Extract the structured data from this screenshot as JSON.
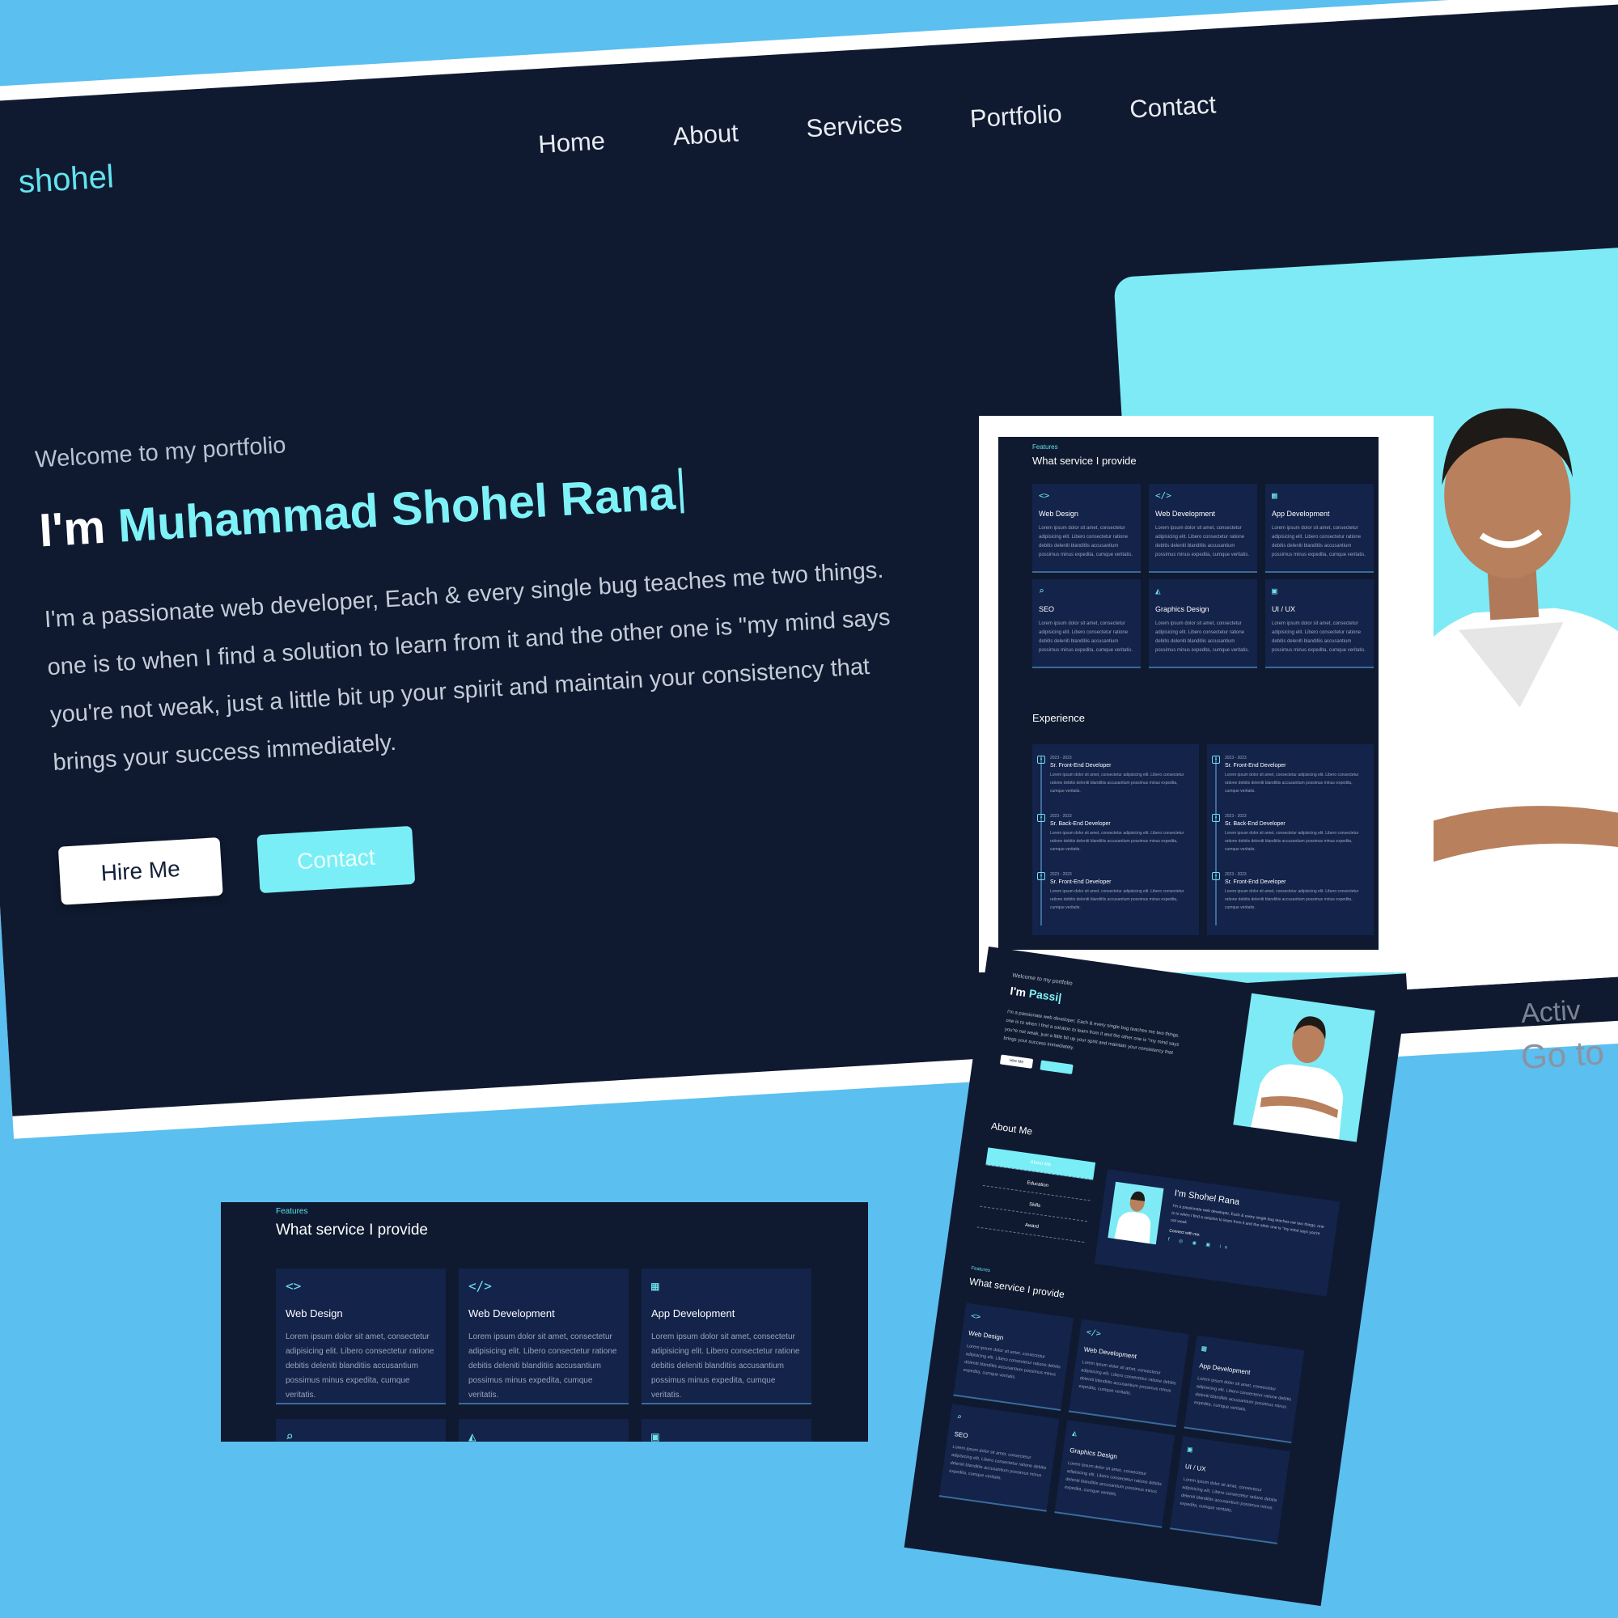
{
  "hero": {
    "logo": "shohel",
    "nav": [
      "Home",
      "About",
      "Services",
      "Portfolio",
      "Contact"
    ],
    "welcome": "Welcome to my portfolio",
    "greeting": "I'm ",
    "name": "Muhammad Shohel Rana",
    "intro": "I'm a passionate web developer, Each & every single bug teaches me two things. one is to when I find a solution to learn from it and the other one is \"my mind says you're not weak, just a little bit up your spirit and maintain your consistency that brings your success immediately.",
    "hire_label": "Hire Me",
    "contact_label": "Contact",
    "watermark_line1": "Activ",
    "watermark_line2": "Go to"
  },
  "services": {
    "eyebrow": "Features",
    "title": "What service I provide",
    "items": [
      {
        "icon": "code-icon",
        "glyph": "<>",
        "title": "Web Design",
        "text": "Lorem ipsum dolor sit amet, consectetur adipisicing elit. Libero consectetur ratione debitis deleniti blanditiis accusantium possimus minus expedita, cumque veritatis."
      },
      {
        "icon": "code-slash-icon",
        "glyph": "</>",
        "title": "Web Development",
        "text": "Lorem ipsum dolor sit amet, consectetur adipisicing elit. Libero consectetur ratione debitis deleniti blanditiis accusantium possimus minus expedita, cumque veritatis."
      },
      {
        "icon": "qr-code-icon",
        "glyph": "▦",
        "title": "App Development",
        "text": "Lorem ipsum dolor sit amet, consectetur adipisicing elit. Libero consectetur ratione debitis deleniti blanditiis accusantium possimus minus expedita, cumque veritatis."
      },
      {
        "icon": "search-icon",
        "glyph": "⌕",
        "title": "SEO",
        "text": "Lorem ipsum dolor sit amet, consectetur adipisicing elit. Libero consectetur ratione debitis deleniti blanditiis accusantium possimus minus expedita, cumque veritatis."
      },
      {
        "icon": "image-icon",
        "glyph": "◭",
        "title": "Graphics Design",
        "text": "Lorem ipsum dolor sit amet, consectetur adipisicing elit. Libero consectetur ratione debitis deleniti blanditiis accusantium possimus minus expedita, cumque veritatis."
      },
      {
        "icon": "layout-icon",
        "glyph": "▣",
        "title": "UI / UX",
        "text": "Lorem ipsum dolor sit amet, consectetur adipisicing elit. Libero consectetur ratione debitis deleniti blanditiis accusantium possimus minus expedita, cumque veritatis."
      }
    ]
  },
  "experience": {
    "title": "Experience",
    "columns": [
      [
        {
          "date": "2023 - 2023",
          "role": "Sr. Front-End Developer",
          "text": "Lorem ipsum dolor sit amet, consectetur adipisicing elit. Libero consectetur ratione debitis deleniti blanditiis accusantium possimus minus expedita, cumque veritatis."
        },
        {
          "date": "2023 - 2023",
          "role": "Sr. Back-End Developer",
          "text": "Lorem ipsum dolor sit amet, consectetur adipisicing elit. Libero consectetur ratione debitis deleniti blanditiis accusantium possimus minus expedita, cumque veritatis."
        },
        {
          "date": "2023 - 2023",
          "role": "Sr. Front-End Developer",
          "text": "Lorem ipsum dolor sit amet, consectetur adipisicing elit. Libero consectetur ratione debitis deleniti blanditiis accusantium possimus minus expedita, cumque veritatis."
        }
      ],
      [
        {
          "date": "2023 - 2023",
          "role": "Sr. Front-End Developer",
          "text": "Lorem ipsum dolor sit amet, consectetur adipisicing elit. Libero consectetur ratione debitis deleniti blanditiis accusantium possimus minus expedita, cumque veritatis."
        },
        {
          "date": "2023 - 2023",
          "role": "Sr. Back-End Developer",
          "text": "Lorem ipsum dolor sit amet, consectetur adipisicing elit. Libero consectetur ratione debitis deleniti blanditiis accusantium possimus minus expedita, cumque veritatis."
        },
        {
          "date": "2023 - 2023",
          "role": "Sr. Front-End Developer",
          "text": "Lorem ipsum dolor sit amet, consectetur adipisicing elit. Libero consectetur ratione debitis deleniti blanditiis accusantium possimus minus expedita, cumque veritatis."
        }
      ]
    ]
  },
  "mobile": {
    "welcome": "Welcome to my portfolio",
    "greeting": "I'm ",
    "typed": "Passi|",
    "intro": "I'm a passionate web developer, Each & every single bug teaches me two things. one is to when I find a solution to learn from it and the other one is \"my mind says you're not weak, just a little bit up your spirit and maintain your consistency that brings your success immediately.",
    "hire_label": "Hire Me",
    "about_title": "About Me",
    "tabs": [
      "About Me",
      "Education",
      "Skills",
      "Award"
    ],
    "profile_name": "I'm Shohel Rana",
    "profile_text": "I'm a passionate web developer, Each & every single bug teaches me two things. one is to when I find a solution to learn from it and the other one is \"my mind says you're not weak",
    "connect_label": "Connect with me:",
    "social_glyphs": "f ◎ ◉ ▣ in"
  },
  "colors": {
    "background": "#5bbfef",
    "page_dark": "#0f1a30",
    "card": "#13234a",
    "accent": "#79eef6"
  }
}
